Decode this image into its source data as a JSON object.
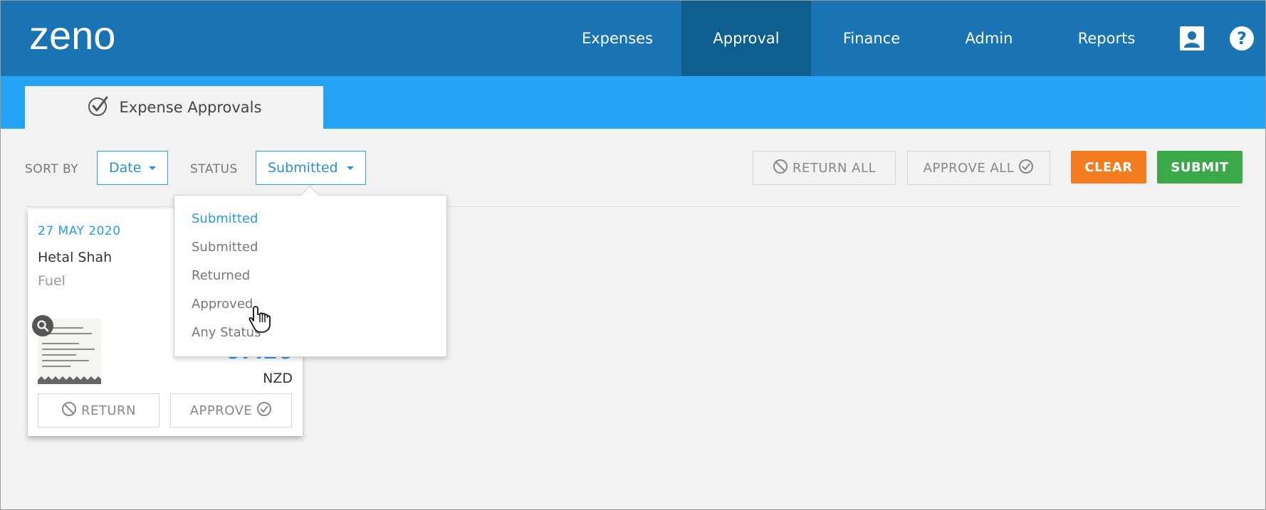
{
  "header": {
    "logo_text": "zeno",
    "nav": [
      {
        "label": "Expenses"
      },
      {
        "label": "Approval"
      },
      {
        "label": "Finance"
      },
      {
        "label": "Admin"
      },
      {
        "label": "Reports"
      }
    ],
    "icons": [
      "user-icon",
      "help-icon"
    ]
  },
  "subbar": {
    "tab_label": "Expense Approvals",
    "tab_icon": "check-circle-icon"
  },
  "toolbar": {
    "sort_label": "SORT BY",
    "sort_value": "Date",
    "status_label": "STATUS",
    "status_value": "Submitted",
    "return_all": "RETURN ALL",
    "approve_all": "APPROVE ALL",
    "clear": "CLEAR",
    "submit": "SUBMIT"
  },
  "card": {
    "date": "27 MAY 2020",
    "name": "Hetal Shah",
    "category": "Fuel",
    "amount": "67.26",
    "currency": "NZD",
    "return_label": "RETURN",
    "approve_label": "APPROVE"
  },
  "status_dropdown": {
    "options": [
      "Submitted",
      "Submitted",
      "Returned",
      "Approved",
      "Any Status"
    ],
    "selected_index": 0
  },
  "colors": {
    "nav_bg": "#1a74b3",
    "nav_active": "#0f5e90",
    "subbar_bg": "#27a3f5",
    "accent_blue": "#2a9be8",
    "clear_orange": "#f47c20",
    "submit_green": "#3ba94a"
  }
}
